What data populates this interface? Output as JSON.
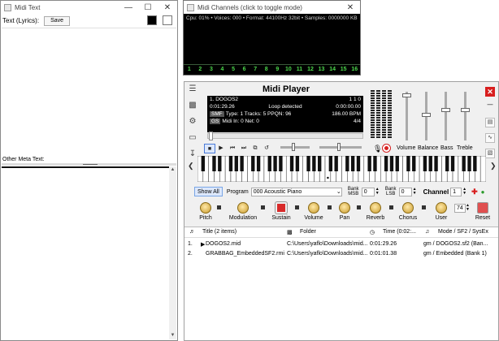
{
  "midi_text": {
    "title": "Midi Text",
    "lyrics_label": "Text (Lyrics):",
    "save_label": "Save",
    "meta_label": "Other Meta Text:"
  },
  "midi_channels": {
    "title": "Midi Channels (click to toggle mode)",
    "status": "Cpu: 01% • Voices: 000 • Format: 44100Hz 32bit • Samples: 0000000 KB",
    "channels": [
      "1",
      "2",
      "3",
      "4",
      "5",
      "6",
      "7",
      "8",
      "9",
      "10",
      "11",
      "12",
      "13",
      "14",
      "15",
      "16"
    ]
  },
  "player": {
    "title": "Midi Player",
    "lcd": {
      "song": "1. DOGOS2",
      "counters": "1     1     0",
      "time": "0:01:29.26",
      "loop": "Loop detected",
      "time_right": "0:00:00.00",
      "tag1": "SMF",
      "type_info": "Type: 1  Tracks: 5  PPQN: 96",
      "bpm": "186.00 BPM",
      "tag2": "GS",
      "midi_in": "Midi In: 0   Net: 0",
      "sig": "4/4"
    },
    "labels": {
      "volume": "Volume",
      "balance": "Balance",
      "bass": "Bass",
      "treble": "Treble"
    },
    "program_row": {
      "show_all": "Show All",
      "program_label": "Program",
      "program_value": "000 Acoustic Piano",
      "bank_msb_label": "Bank MSB",
      "bank_msb_value": "0",
      "bank_lsb_label": "Bank LSB",
      "bank_lsb_value": "0",
      "channel_label": "Channel",
      "channel_value": "1"
    },
    "knobs": {
      "pitch": "Pitch",
      "modulation": "Modulation",
      "sustain": "Sustain",
      "volume": "Volume",
      "pan": "Pan",
      "reverb": "Reverb",
      "chorus": "Chorus",
      "user": "User",
      "user_value": "74",
      "reset": "Reset"
    },
    "playlist": {
      "headers": {
        "title": "Title (2 items)",
        "folder": "Folder",
        "time": "Time (0:02:...",
        "mode": "Mode / SF2 / SysEx"
      },
      "rows": [
        {
          "num": "1.",
          "title": "DOGOS2.mid",
          "folder": "C:\\Users\\yaflo\\Downloads\\mid...",
          "time": "0:01:29.26",
          "mode": "gm / DOGOS2.sf2 (Ban..."
        },
        {
          "num": "2.",
          "title": "GRABBAG_EmbeddedSF2.rmi",
          "folder": "C:\\Users\\yaflo\\Downloads\\mid...",
          "time": "0:01:01.38",
          "mode": "gm / Embedded (Bank 1)"
        }
      ]
    }
  }
}
